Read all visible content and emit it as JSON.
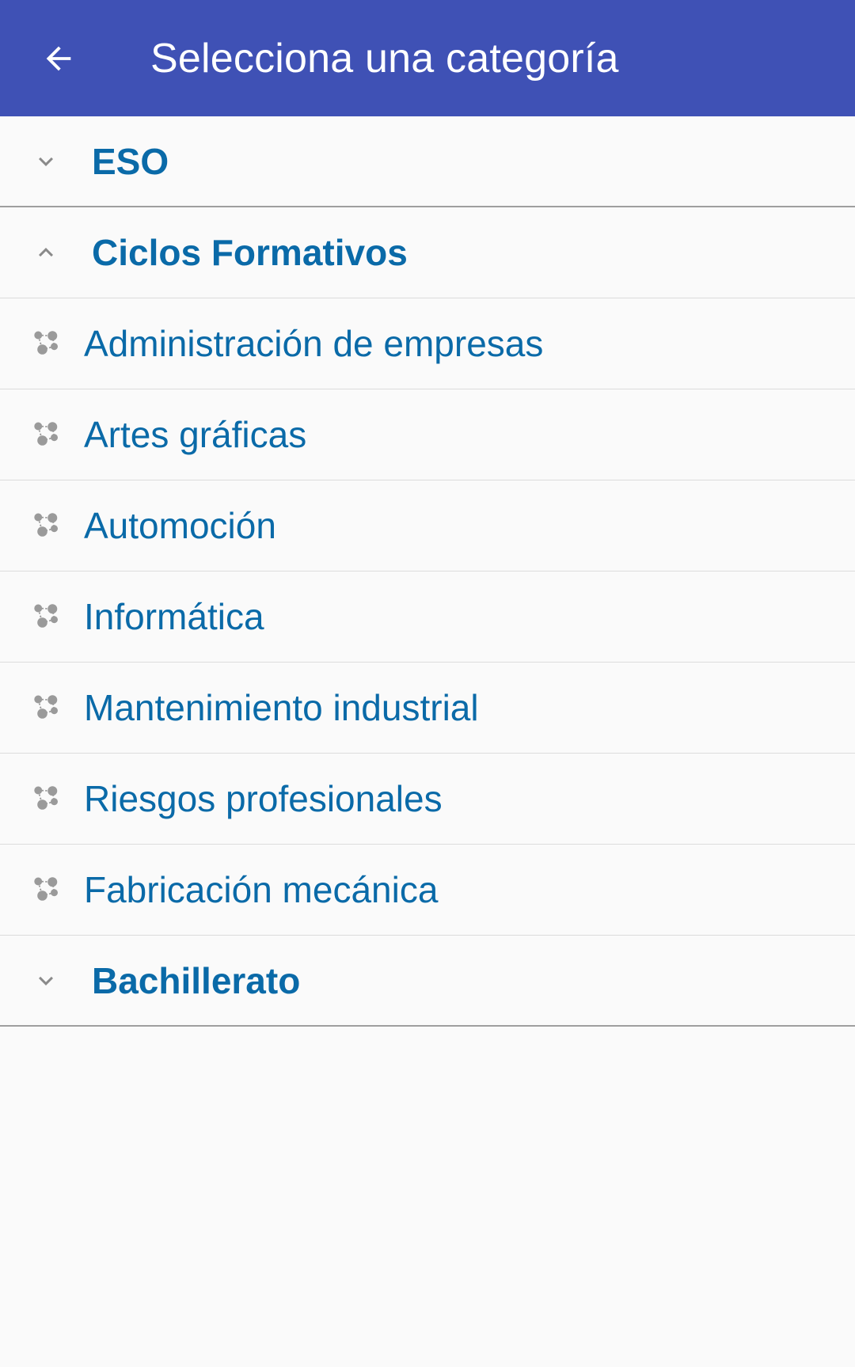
{
  "toolbar": {
    "title": "Selecciona una categoría",
    "back_icon": "arrow-back-icon",
    "background": "#3f51b5"
  },
  "accent": "#0a6aa8",
  "categories": [
    {
      "label": "ESO",
      "expanded": false,
      "icon": "chevron-down-icon",
      "items": []
    },
    {
      "label": "Ciclos Formativos",
      "expanded": true,
      "icon": "chevron-up-icon",
      "items": [
        {
          "label": "Administración de empresas",
          "icon": "category-node-icon"
        },
        {
          "label": "Artes gráficas",
          "icon": "category-node-icon"
        },
        {
          "label": "Automoción",
          "icon": "category-node-icon"
        },
        {
          "label": "Informática",
          "icon": "category-node-icon"
        },
        {
          "label": "Mantenimiento industrial",
          "icon": "category-node-icon"
        },
        {
          "label": "Riesgos profesionales",
          "icon": "category-node-icon"
        },
        {
          "label": "Fabricación mecánica",
          "icon": "category-node-icon"
        }
      ]
    },
    {
      "label": "Bachillerato",
      "expanded": false,
      "icon": "chevron-down-icon",
      "items": []
    }
  ]
}
